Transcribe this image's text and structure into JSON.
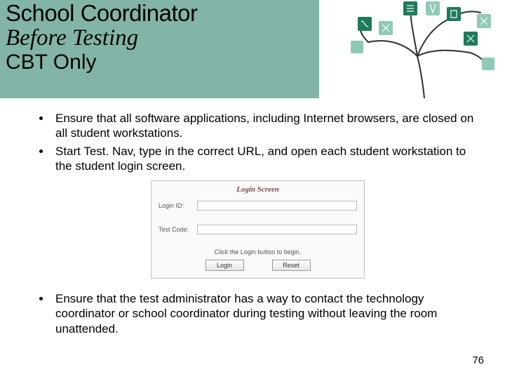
{
  "header": {
    "title1": "School Coordinator",
    "title2": "Before Testing",
    "title3": "CBT Only"
  },
  "bullets": [
    "Ensure that all software applications, including Internet browsers, are closed on all student workstations.",
    "Start Test. Nav, type in the correct URL, and open each student workstation to the student login screen."
  ],
  "login": {
    "title": "Login Screen",
    "label_login": "Login ID:",
    "label_code": "Test Code:",
    "instruction": "Click the Login button to begin.",
    "btn_login": "Login",
    "btn_reset": "Reset"
  },
  "bullets2": [
    "Ensure that the test administrator has a way to contact the technology coordinator or school coordinator during testing without leaving the room unattended."
  ],
  "page_number": "76"
}
